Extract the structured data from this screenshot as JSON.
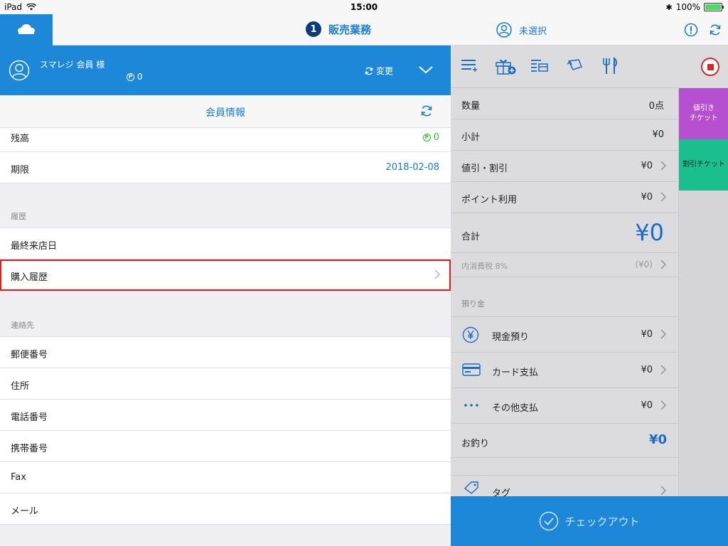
{
  "status_bar": {
    "device": "iPad",
    "time": "15:00",
    "battery": "100%",
    "battery_level": 1.0
  },
  "nav": {
    "tab_number": "1",
    "title": "販売業務",
    "staff": "未選択"
  },
  "member": {
    "name": "スマレジ 会員 様",
    "points": "0",
    "change_label": "変更"
  },
  "section_title": "会員情報",
  "info_rows": [
    {
      "label": "残高",
      "value": "0"
    },
    {
      "label": "期限",
      "value": "2018-02-08"
    }
  ],
  "history": {
    "header": "履歴",
    "rows": [
      {
        "label": "最終来店日"
      },
      {
        "label": "購入履歴"
      }
    ]
  },
  "contact": {
    "header": "連絡先",
    "rows": [
      {
        "label": "郵便番号"
      },
      {
        "label": "住所"
      },
      {
        "label": "電話番号"
      },
      {
        "label": "携帯番号"
      },
      {
        "label": "Fax"
      },
      {
        "label": "メール"
      }
    ]
  },
  "summary": {
    "quantity": {
      "label": "数量",
      "value": "0点"
    },
    "subtotal": {
      "label": "小計",
      "value": "¥0"
    },
    "discount": {
      "label": "値引・割引",
      "value": "¥0"
    },
    "points_used": {
      "label": "ポイント利用",
      "value": "¥0"
    },
    "total": {
      "label": "合計",
      "value": "¥0"
    },
    "tax": {
      "label": "内消費税 8%",
      "value": "(¥0)"
    },
    "deposit_header": "預り金",
    "payments": [
      {
        "label": "現金預り",
        "value": "¥0",
        "icon": "yen-circle-icon"
      },
      {
        "label": "カード支払",
        "value": "¥0",
        "icon": "credit-card-icon"
      },
      {
        "label": "その他支払",
        "value": "¥0",
        "icon": "more-dots-icon"
      }
    ],
    "change": {
      "label": "お釣り",
      "value": "¥0"
    },
    "tag": {
      "label": "タグ"
    }
  },
  "tickets": [
    {
      "label": "値引き チケット",
      "color": "#b64fd0"
    },
    {
      "label": "割引チケット",
      "color": "#1abf8d"
    }
  ],
  "checkout_label": "チェックアウト",
  "colors": {
    "brand": "#1e88d8",
    "accent_text": "#1a7cd4",
    "highlight_border": "#e31b1b",
    "points_green": "#2eb82e"
  }
}
